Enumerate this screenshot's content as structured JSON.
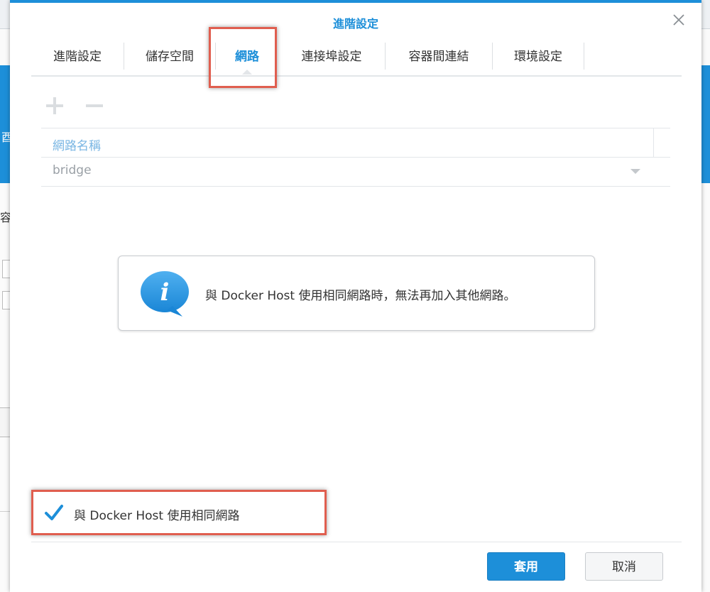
{
  "dialog": {
    "title": "進階設定",
    "tabs": [
      {
        "label": "進階設定",
        "active": false
      },
      {
        "label": "儲存空間",
        "active": false
      },
      {
        "label": "網路",
        "active": true
      },
      {
        "label": "連接埠設定",
        "active": false
      },
      {
        "label": "容器間連結",
        "active": false
      },
      {
        "label": "環境設定",
        "active": false
      }
    ],
    "toolbar": {
      "add_icon": "plus-icon",
      "remove_icon": "minus-icon"
    },
    "network_table": {
      "column_header": "網路名稱",
      "rows": [
        {
          "name": "bridge"
        }
      ]
    },
    "info_message": "與 Docker Host 使用相同網路時，無法再加入其他網路。",
    "host_network_checkbox": {
      "label": "與 Docker Host 使用相同網路",
      "checked": true
    },
    "buttons": {
      "apply": "套用",
      "cancel": "取消"
    }
  },
  "background": {
    "partial_chars": [
      "酉",
      "容"
    ]
  },
  "colors": {
    "accent": "#1d8fd9",
    "highlight": "#e05e4f"
  }
}
